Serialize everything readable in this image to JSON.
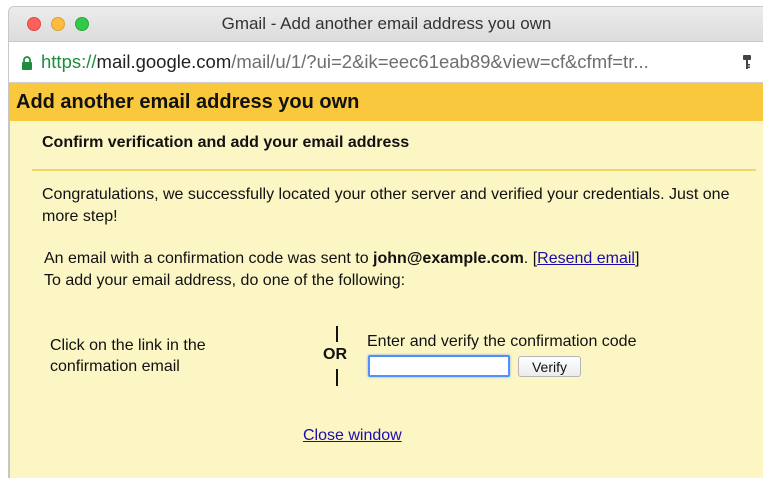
{
  "window": {
    "title": "Gmail - Add another email address you own"
  },
  "address_bar": {
    "scheme": "https://",
    "host": "mail.google.com",
    "path": "/mail/u/1/?ui=2&ik=eec61eab89&view=cf&cfmf=tr...",
    "secure": true
  },
  "page": {
    "header_title": "Add another email address you own",
    "subtitle": "Confirm verification and add your email address",
    "congrats": "Congratulations, we successfully located your other server and verified your credentials. Just one more step!",
    "sent_prefix": "An email with a confirmation code was sent to ",
    "email": "john@example.com",
    "sent_suffix": ". [",
    "resend_link": "Resend email",
    "sent_end": "]",
    "instructions": "To add your email address, do one of the following:",
    "option_link_text": "Click on the link in the confirmation email",
    "or_label": "OR",
    "option_code_text": "Enter and verify the confirmation code",
    "code_value": "",
    "verify_label": "Verify",
    "close_link": "Close window"
  },
  "colors": {
    "header_bg": "#f9c83c",
    "content_bg": "#fcf5c4",
    "link": "#1a0dab",
    "secure_green": "#1e8e3e",
    "input_focus": "#4d90fe"
  },
  "icons": [
    "lock-icon",
    "key-icon"
  ]
}
